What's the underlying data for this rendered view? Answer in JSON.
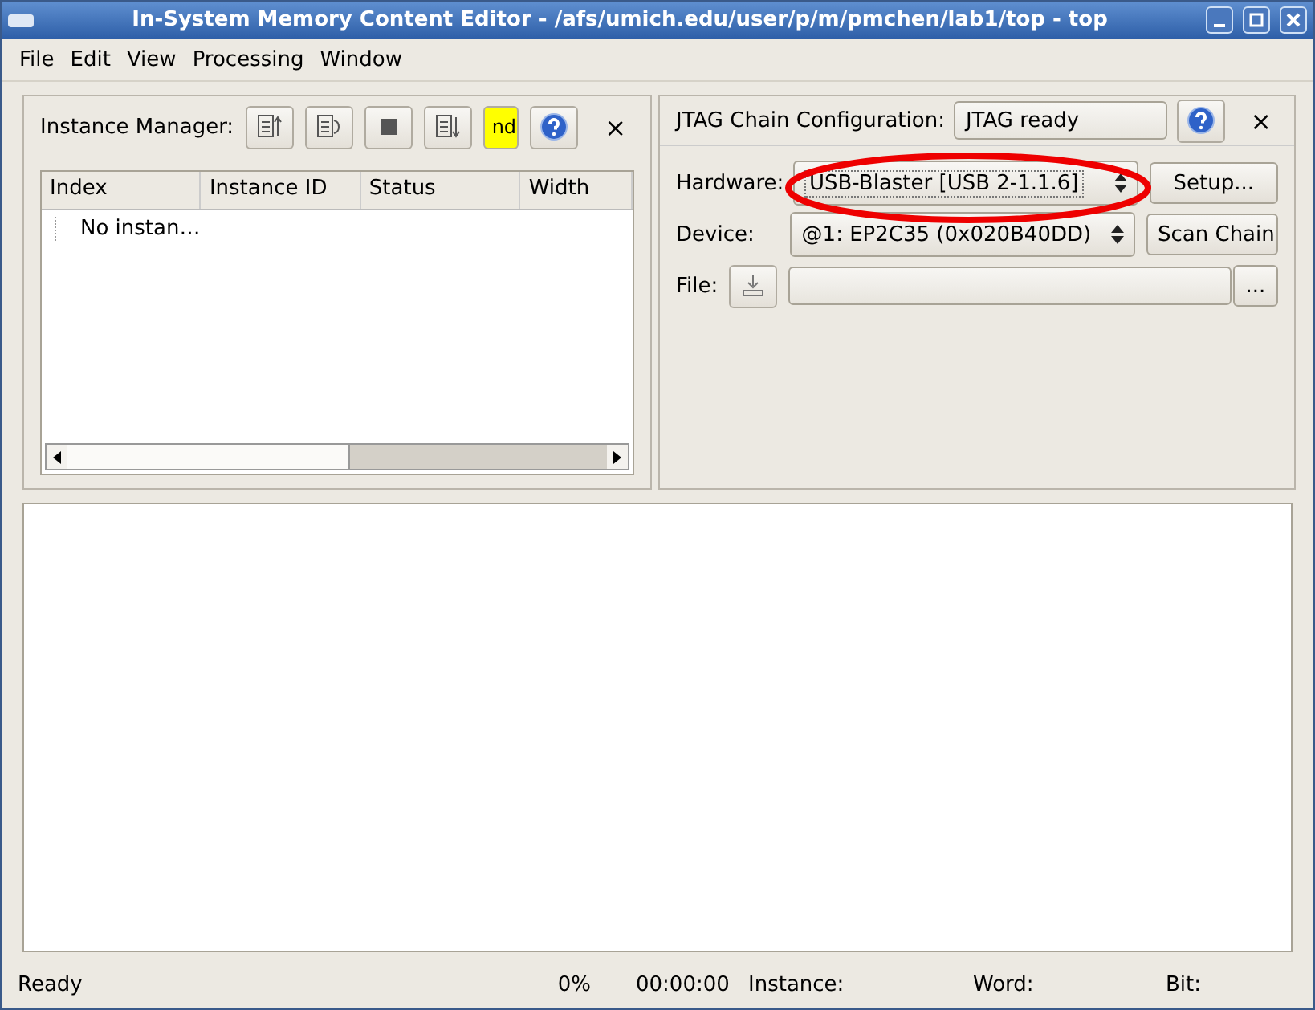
{
  "window": {
    "title": "In-System Memory Content Editor - /afs/umich.edu/user/p/m/pmchen/lab1/top - top"
  },
  "menu": [
    {
      "label": "File"
    },
    {
      "label": "Edit"
    },
    {
      "label": "View"
    },
    {
      "label": "Processing"
    },
    {
      "label": "Window"
    }
  ],
  "instance_manager": {
    "label": "Instance Manager:",
    "close": "×",
    "toolbar": [
      {
        "kind": "read"
      },
      {
        "kind": "write"
      },
      {
        "kind": "stop"
      },
      {
        "kind": "export"
      },
      {
        "kind": "text",
        "label": "nd"
      },
      {
        "kind": "help"
      }
    ],
    "columns": [
      "Index",
      "Instance ID",
      "Status",
      "Width"
    ],
    "rows": [
      {
        "label": "No instan…"
      }
    ]
  },
  "jtag": {
    "label": "JTAG Chain Configuration:",
    "status": "JTAG ready",
    "close": "×",
    "hardware": {
      "label": "Hardware:",
      "value": "USB-Blaster [USB 2-1.1.6]",
      "button": "Setup..."
    },
    "device": {
      "label": "Device:",
      "value": "@1: EP2C35 (0x020B40DD)",
      "button": "Scan Chain"
    },
    "file": {
      "label": "File:",
      "browse": "..."
    }
  },
  "status_bar": [
    "Ready",
    "0%",
    "00:00:00",
    "Instance:",
    "Word:",
    "Bit:"
  ]
}
